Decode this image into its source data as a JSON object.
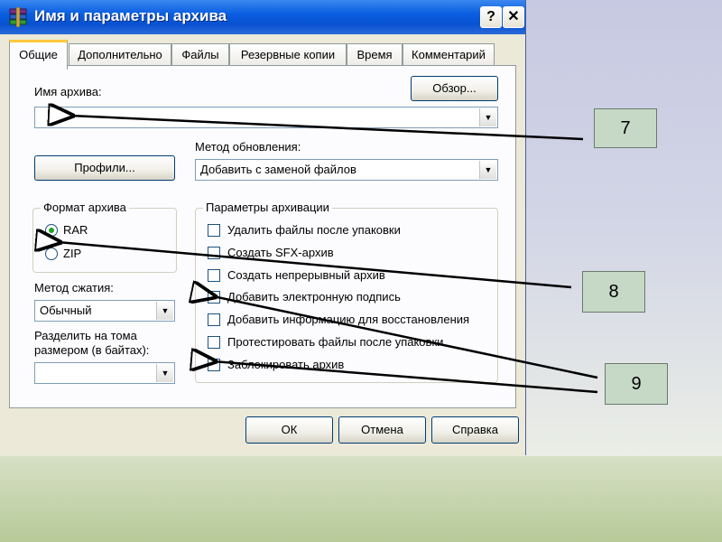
{
  "window": {
    "title": "Имя и параметры архива",
    "help_label": "?",
    "close_label": "✕",
    "icon": "winrar-app-icon"
  },
  "tabs": [
    {
      "label": "Общие",
      "active": true
    },
    {
      "label": "Дополнительно",
      "active": false
    },
    {
      "label": "Файлы",
      "active": false
    },
    {
      "label": "Резервные копии",
      "active": false
    },
    {
      "label": "Время",
      "active": false
    },
    {
      "label": "Комментарий",
      "active": false
    }
  ],
  "general": {
    "archive_name_label": "Имя архива:",
    "archive_name_value": "",
    "browse_label": "Обзор...",
    "profiles_label": "Профили...",
    "update_method_label": "Метод обновления:",
    "update_method_value": "Добавить с заменой файлов",
    "format_group_title": "Формат архива",
    "format_options": [
      {
        "label": "RAR",
        "checked": true
      },
      {
        "label": "ZIP",
        "checked": false
      }
    ],
    "compression_label": "Метод сжатия:",
    "compression_value": "Обычный",
    "split_label_line1": "Разделить на тома",
    "split_label_line2": "размером (в байтах):",
    "split_value": "",
    "params_group_title": "Параметры архивации",
    "params": [
      {
        "label": "Удалить файлы после упаковки",
        "checked": false
      },
      {
        "label": "Создать SFX-архив",
        "checked": false
      },
      {
        "label": "Создать непрерывный архив",
        "checked": false
      },
      {
        "label": "Добавить электронную подпись",
        "checked": false
      },
      {
        "label": "Добавить информацию для восстановления",
        "checked": false
      },
      {
        "label": "Протестировать файлы после упаковки",
        "checked": false
      },
      {
        "label": "Заблокировать архив",
        "checked": false
      }
    ]
  },
  "footer": {
    "ok_label": "ОК",
    "cancel_label": "Отмена",
    "help_label": "Справка"
  },
  "callouts": {
    "c7": "7",
    "c8": "8",
    "c9": "9"
  },
  "colors": {
    "titlebar": "#0752d1",
    "callout_fill": "#c6d9c6",
    "tab_highlight": "#ffc83c"
  }
}
